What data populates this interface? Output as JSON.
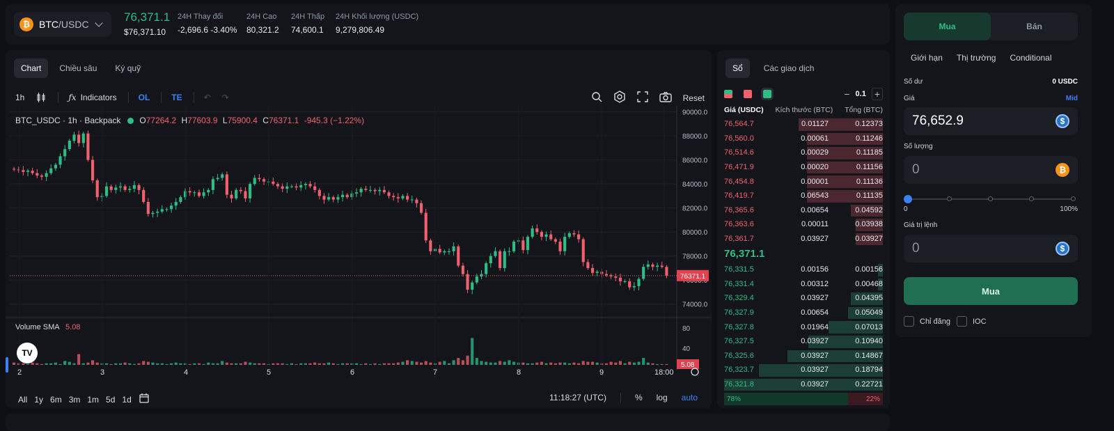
{
  "ticker": {
    "pair_base": "BTC",
    "pair_quote": "/USDC",
    "coin_symbol": "₿",
    "last_price": "76,371.1",
    "last_price_usd": "$76,371.10",
    "stats": [
      {
        "label": "24H Thay đổi",
        "value": "-2,696.6 -3.40%",
        "tone": "red"
      },
      {
        "label": "24H Cao",
        "value": "80,321.2",
        "tone": "normal"
      },
      {
        "label": "24H Thấp",
        "value": "74,600.1",
        "tone": "normal"
      },
      {
        "label": "24H Khối lượng (USDC)",
        "value": "9,279,806.49",
        "tone": "normal"
      }
    ]
  },
  "chart_tabs": [
    "Chart",
    "Chiều sâu",
    "Ký quỹ"
  ],
  "toolbar": {
    "interval": "1h",
    "indicators": "Indicators",
    "ol": "OL",
    "te": "TE",
    "reset": "Reset"
  },
  "legend": {
    "symbol": "BTC_USDC · 1h · Backpack",
    "o_label": "O",
    "o": "77264.2",
    "h_label": "H",
    "h": "77603.9",
    "l_label": "L",
    "l": "75900.4",
    "c_label": "C",
    "c": "76371.1",
    "change": "-945.3 (−1.22%)"
  },
  "volume": {
    "label": "Volume SMA",
    "value": "5.08"
  },
  "tv_logo": "TV",
  "range_buttons": [
    "All",
    "1y",
    "6m",
    "3m",
    "1m",
    "5d",
    "1d"
  ],
  "bottom_right": {
    "time": "11:18:27 (UTC)",
    "percent": "%",
    "log": "log",
    "auto": "auto"
  },
  "chart_data": {
    "type": "candlestick",
    "y_ticks": [
      "90000.0",
      "88000.0",
      "86000.0",
      "84000.0",
      "82000.0",
      "80000.0",
      "78000.0",
      "76000.0",
      "74000.0"
    ],
    "ylim": [
      73000,
      90500
    ],
    "x_ticks": [
      "2",
      "3",
      "4",
      "5",
      "6",
      "7",
      "8",
      "9",
      "18:00"
    ],
    "last_price_label": "76371.1",
    "volume_ticks": [
      "80",
      "40"
    ],
    "volume_last_label": "5.08",
    "closes": [
      85200,
      85150,
      85000,
      85100,
      84900,
      84700,
      84600,
      84900,
      85300,
      85600,
      86300,
      86900,
      87600,
      88100,
      87400,
      88200,
      86000,
      84300,
      82900,
      83000,
      83800,
      83500,
      83700,
      83800,
      83500,
      83600,
      83900,
      83500,
      82500,
      81500,
      81600,
      81700,
      81900,
      81900,
      82200,
      82500,
      82900,
      83400,
      83300,
      83300,
      83000,
      83300,
      83500,
      84400,
      84500,
      84800,
      83100,
      82800,
      83500,
      83400,
      82800,
      84000,
      84500,
      84400,
      84200,
      84200,
      84000,
      83800,
      83600,
      83800,
      83800,
      83700,
      83900,
      84000,
      83800,
      83500,
      83000,
      82700,
      82900,
      82700,
      82900,
      83100,
      82900,
      83200,
      83300,
      83600,
      83500,
      83500,
      83400,
      83500,
      83300,
      83000,
      82900,
      82800,
      83000,
      82700,
      82700,
      82400,
      81600,
      79300,
      78400,
      78600,
      78300,
      78400,
      78400,
      78800,
      77200,
      76500,
      75200,
      75800,
      76300,
      76500,
      77400,
      78000,
      78400,
      77000,
      78400,
      78400,
      79200,
      79300,
      78500,
      79600,
      80300,
      80000,
      79600,
      79800,
      79400,
      79200,
      78400,
      79600,
      79900,
      79800,
      79400,
      77500,
      77000,
      76600,
      76700,
      76500,
      76400,
      76300,
      76200,
      75900,
      75900,
      75400,
      75500,
      76100,
      77100,
      77300,
      77100,
      77200,
      77100,
      76371
    ],
    "volumes": [
      3,
      2,
      2,
      1,
      3,
      2,
      1,
      2,
      2,
      3,
      1,
      5,
      4,
      2,
      14,
      2,
      3,
      6,
      3,
      2,
      2,
      1,
      2,
      2,
      3,
      2,
      1,
      2,
      5,
      4,
      3,
      2,
      2,
      1,
      2,
      3,
      2,
      2,
      1,
      2,
      2,
      1,
      3,
      2,
      2,
      5,
      3,
      2,
      2,
      2,
      4,
      3,
      2,
      2,
      2,
      1,
      2,
      2,
      2,
      1,
      2,
      1,
      2,
      2,
      2,
      3,
      2,
      2,
      3,
      2,
      1,
      2,
      2,
      2,
      2,
      1,
      2,
      1,
      2,
      1,
      2,
      2,
      2,
      3,
      4,
      6,
      5,
      4,
      3,
      5,
      3,
      2,
      4,
      5,
      2,
      6,
      9,
      6,
      12,
      35,
      9,
      5,
      4,
      3,
      3,
      5,
      4,
      6,
      4,
      3,
      3,
      2,
      2,
      3,
      4,
      2,
      3,
      2,
      3,
      3,
      2,
      3,
      2,
      5,
      4,
      4,
      3,
      2,
      2,
      4,
      3,
      5,
      2,
      4,
      3,
      4,
      9,
      3,
      2
    ]
  },
  "book": {
    "tabs": [
      "Sổ",
      "Các giao dịch"
    ],
    "step": "0.1",
    "headers": [
      "Giá (USDC)",
      "Kích thước (BTC)",
      "Tổng (BTC)"
    ],
    "asks": [
      {
        "price": "76,564.7",
        "size": "0.01127",
        "total": "0.12373",
        "depth": 0.53
      },
      {
        "price": "76,560.0",
        "size": "0.00061",
        "total": "0.11246",
        "depth": 0.48
      },
      {
        "price": "76,514.6",
        "size": "0.00029",
        "total": "0.11185",
        "depth": 0.48
      },
      {
        "price": "76,471.9",
        "size": "0.00020",
        "total": "0.11156",
        "depth": 0.48
      },
      {
        "price": "76,454.8",
        "size": "0.00001",
        "total": "0.11136",
        "depth": 0.48
      },
      {
        "price": "76,419.7",
        "size": "0.06543",
        "total": "0.11135",
        "depth": 0.48
      },
      {
        "price": "76,365.6",
        "size": "0.00654",
        "total": "0.04592",
        "depth": 0.2
      },
      {
        "price": "76,363.6",
        "size": "0.00011",
        "total": "0.03938",
        "depth": 0.17
      },
      {
        "price": "76,361.7",
        "size": "0.03927",
        "total": "0.03927",
        "depth": 0.17
      }
    ],
    "mid_price": "76,371.1",
    "bids": [
      {
        "price": "76,331.5",
        "size": "0.00156",
        "total": "0.00156",
        "depth": 0.03
      },
      {
        "price": "76,331.4",
        "size": "0.00312",
        "total": "0.00468",
        "depth": 0.03
      },
      {
        "price": "76,329.4",
        "size": "0.03927",
        "total": "0.04395",
        "depth": 0.2
      },
      {
        "price": "76,327.9",
        "size": "0.00654",
        "total": "0.05049",
        "depth": 0.22
      },
      {
        "price": "76,327.8",
        "size": "0.01964",
        "total": "0.07013",
        "depth": 0.34
      },
      {
        "price": "76,327.5",
        "size": "0.03927",
        "total": "0.10940",
        "depth": 0.47
      },
      {
        "price": "76,325.6",
        "size": "0.03927",
        "total": "0.14867",
        "depth": 0.6
      },
      {
        "price": "76,323.7",
        "size": "0.03927",
        "total": "0.18794",
        "depth": 0.78
      },
      {
        "price": "76,321.8",
        "size": "0.03927",
        "total": "0.22721",
        "depth": 1.0
      }
    ],
    "bid_ratio": "78%",
    "ask_ratio": "22%"
  },
  "form": {
    "buy_tab": "Mua",
    "sell_tab": "Bán",
    "order_types": [
      "Giới hạn",
      "Thị trường",
      "Conditional"
    ],
    "balance_label": "Số dư",
    "balance_value": "0 USDC",
    "price_label": "Giá",
    "mid_link": "Mid",
    "price_value": "76,652.9",
    "qty_label": "Số lượng",
    "qty_value": "0",
    "slider_min": "0",
    "slider_max": "100%",
    "slider_level": 0,
    "order_value_label": "Giá trị lệnh",
    "order_value": "0",
    "submit": "Mua",
    "post_only": "Chỉ đăng",
    "ioc": "IOC",
    "usdc_symbol": "$",
    "btc_symbol": "₿"
  },
  "colors": {
    "green": "#2ebd85",
    "red": "#f0616d",
    "accent": "#3b82f6"
  }
}
